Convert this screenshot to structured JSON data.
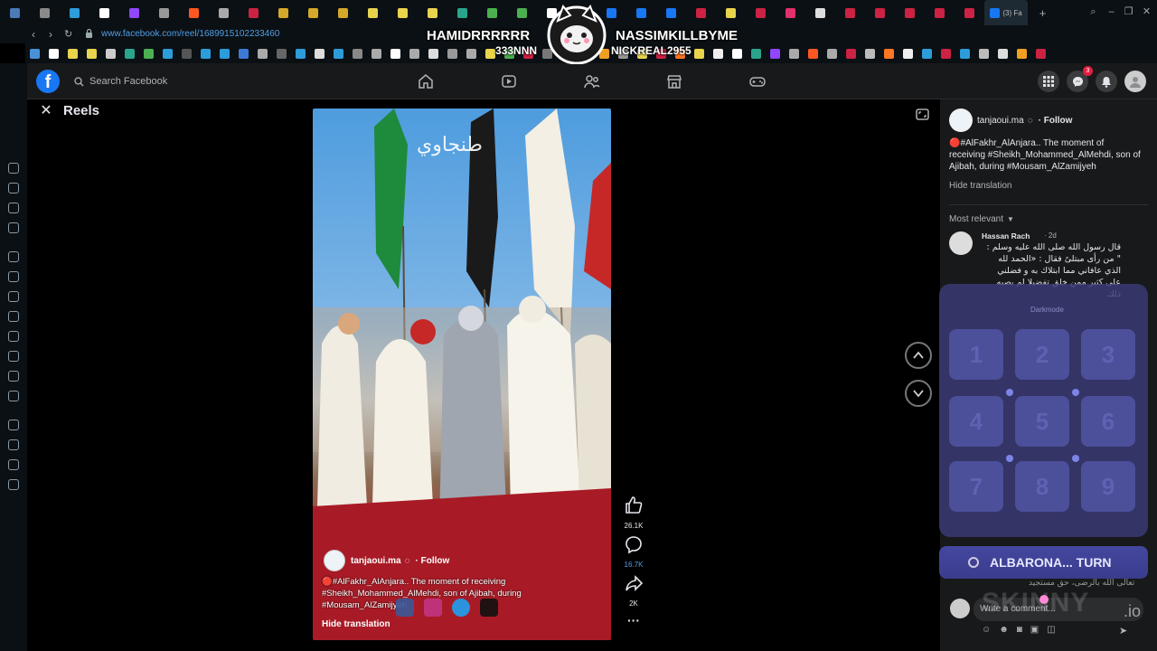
{
  "browser": {
    "url": "www.facebook.com/reel/1689915102233460",
    "active_tab_label": "(3) Fa",
    "tab_colors": [
      "#4a7bb7",
      "#8a8a8a",
      "#2d9cdb",
      "#ffffff",
      "#9146ff",
      "#999999",
      "#ff5722",
      "#aaaaaa",
      "#cc2244",
      "#d4a82a",
      "#d4a82a",
      "#d4a82a",
      "#e8d44d",
      "#e8d44d",
      "#e8d44d",
      "#2aa58c",
      "#4caf50",
      "#4caf50",
      "#ffffff",
      "#e8d44d",
      "#1877f2",
      "#1877f2",
      "#1877f2",
      "#cc2244",
      "#e8d44d",
      "#cc2244",
      "#e1306c",
      "#dddddd",
      "#cc2244",
      "#cc2244",
      "#cc2244",
      "#cc2244",
      "#cc2244"
    ],
    "bookmark_colors": [
      "#4a90d9",
      "#ffffff",
      "#e8d44d",
      "#e8d44d",
      "#cccccc",
      "#2aa58c",
      "#4caf50",
      "#2d9cdb",
      "#555555",
      "#2d9cdb",
      "#2d9cdb",
      "#3d7ad6",
      "#aaaaaa",
      "#666666",
      "#2d9cdb",
      "#dddddd",
      "#2d9cdb",
      "#888888",
      "#aaaaaa",
      "#ffffff",
      "#aaaaaa",
      "#dddddd",
      "#999999",
      "#aaaaaa",
      "#e8d44d",
      "#4caf50",
      "#cc2244",
      "#777777",
      "#d4a82a",
      "#d4a82a",
      "#f0a020",
      "#999999",
      "#e8d44d",
      "#cc2244",
      "#ff7722",
      "#e8d44d",
      "#eeeeee",
      "#ffffff",
      "#2aa58c",
      "#9146ff",
      "#aaaaaa",
      "#ff5722",
      "#aaaaaa",
      "#cc2244",
      "#bbbbbb",
      "#ff7722",
      "#eeeeee",
      "#2d9cdb",
      "#cc2244",
      "#2d9cdb",
      "#bbbbbb",
      "#dddddd",
      "#f0a020",
      "#cc2244"
    ]
  },
  "overlay": {
    "name_left": "HAMIDRRRRRR",
    "name_right": "NASSIMKILLBYME",
    "sub_left": "333NNN",
    "sub_right": "NICKREAL2955"
  },
  "fb": {
    "search_placeholder": "Search Facebook",
    "notifications_count": "3",
    "brand_color": "#1877f2"
  },
  "reels": {
    "title": "Reels",
    "watermark": "طنجاوي",
    "author": "tanjaoui.ma",
    "follow": "Follow",
    "caption": "🔴#AlFakhr_AlAnjara.. The moment of receiving #Sheikh_Mohammed_AlMehdi, son of Ajibah, during #Mousam_AlZamijyeh",
    "hide_translation": "Hide translation",
    "likes": "26.1K",
    "comments": "16.7K",
    "shares": "2K",
    "more": "···"
  },
  "panel": {
    "author": "tanjaoui.ma",
    "follow": "Follow",
    "caption": "🔴#AlFakhr_AlAnjara.. The moment of receiving #Sheikh_Mohammed_AlMehdi, son of Ajibah, during #Mousam_AlZamijyeh",
    "hide_translation": "Hide translation",
    "sort_label": "Most relevant",
    "comment": {
      "name": "Hassan Rach",
      "time": "· 2d",
      "text": "قال رسول الله صلى الله عليه وسلم : \" من رأى مبتلىً فقال : «الحمد لله الذي عافاني مما ابتلاك به و فضلني على كثير ممن خلق تفضيلا لم يصبه ذلك"
    },
    "bottom_text": "تعالى الله بالرضى، حق مستجيد",
    "write_placeholder": "Write a comment..."
  },
  "keypad": {
    "label": "Darkmode",
    "keys": [
      "1",
      "2",
      "3",
      "4",
      "5",
      "6",
      "7",
      "8",
      "9"
    ],
    "turn_label": "ALBARONA... TURN",
    "brand": "SKINNY",
    "brand_suffix": ".io"
  }
}
